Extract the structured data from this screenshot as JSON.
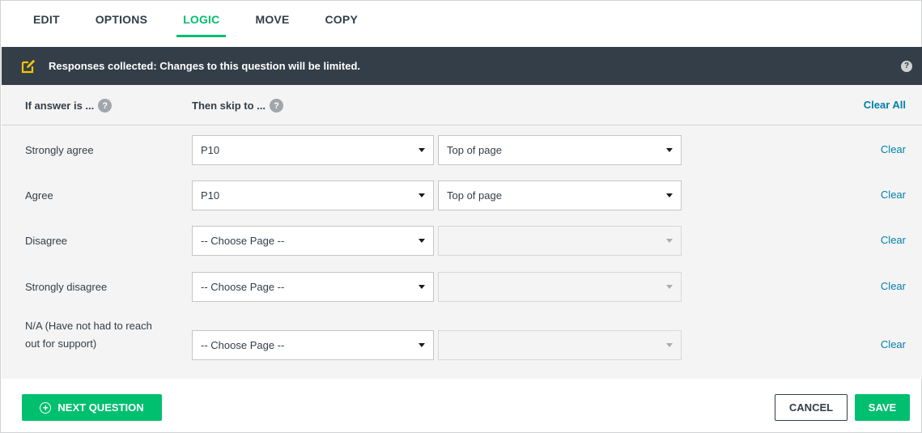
{
  "tabs": [
    {
      "label": "EDIT",
      "active": false
    },
    {
      "label": "OPTIONS",
      "active": false
    },
    {
      "label": "LOGIC",
      "active": true
    },
    {
      "label": "MOVE",
      "active": false
    },
    {
      "label": "COPY",
      "active": false
    }
  ],
  "banner": {
    "icon": "edit-icon",
    "text": "Responses collected: Changes to this question will be limited.",
    "help_symbol": "?"
  },
  "logic": {
    "header_if": "If answer is ...",
    "header_then": "Then skip to ...",
    "help_symbol": "?",
    "clear_all_label": "Clear All",
    "clear_label": "Clear",
    "rows": [
      {
        "answer": "Strongly agree",
        "page": "P10",
        "position": "Top of page",
        "position_enabled": true
      },
      {
        "answer": "Agree",
        "page": "P10",
        "position": "Top of page",
        "position_enabled": true
      },
      {
        "answer": "Disagree",
        "page": "-- Choose Page --",
        "position": "",
        "position_enabled": false
      },
      {
        "answer": "Strongly disagree",
        "page": "-- Choose Page --",
        "position": "",
        "position_enabled": false
      },
      {
        "answer": "N/A (Have not had to reach out for support)",
        "page": "-- Choose Page --",
        "position": "",
        "position_enabled": false
      }
    ]
  },
  "footer": {
    "next_question_label": "NEXT QUESTION",
    "cancel_label": "CANCEL",
    "save_label": "SAVE"
  },
  "colors": {
    "accent": "#00bf6f",
    "link": "#007faa",
    "banner_bg": "#333e48"
  }
}
